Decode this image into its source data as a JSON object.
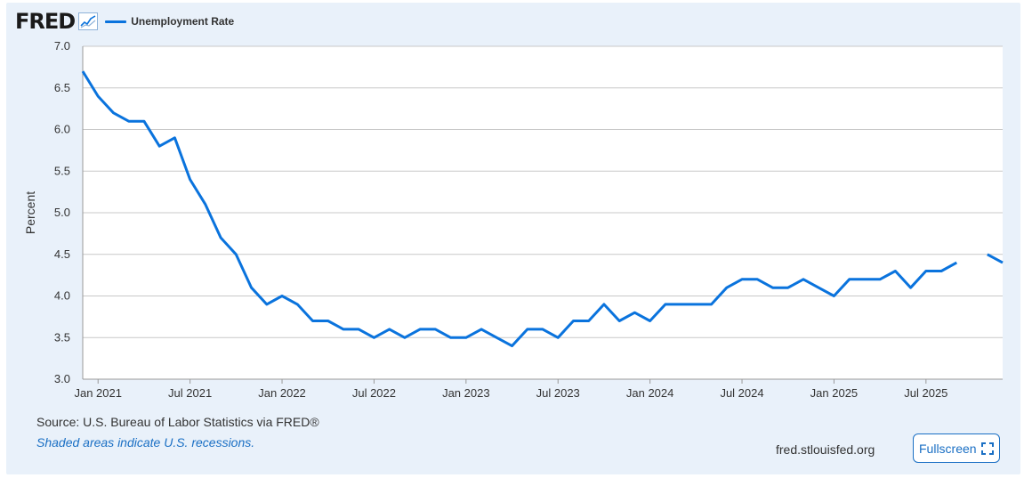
{
  "brand": {
    "logo_text": "FRED",
    "logo_mark_icon": "line-chart-icon"
  },
  "legend": {
    "label": "Unemployment Rate",
    "color": "#0a73dd"
  },
  "footer": {
    "source": "Source: U.S. Bureau of Labor Statistics via FRED®",
    "note": "Shaded areas indicate U.S. recessions.",
    "site": "fred.stlouisfed.org",
    "fullscreen_label": "Fullscreen",
    "fullscreen_icon": "expand-icon"
  },
  "colors": {
    "series": "#0a73dd",
    "panel": "#e9f1fa",
    "plot_bg": "#ffffff",
    "grid": "#c8c8c8",
    "link": "#1a6fc4"
  },
  "chart_data": {
    "type": "line",
    "ylabel": "Percent",
    "xlabel": "",
    "ylim": [
      3.0,
      7.0
    ],
    "ytick_labels": [
      "3.0",
      "3.5",
      "4.0",
      "4.5",
      "5.0",
      "5.5",
      "6.0",
      "6.5",
      "7.0"
    ],
    "yticks": [
      3.0,
      3.5,
      4.0,
      4.5,
      5.0,
      5.5,
      6.0,
      6.5,
      7.0
    ],
    "x_start": "2020-12",
    "x_end": "2025-12",
    "xtick_labels": [
      "Jan 2021",
      "Jul 2021",
      "Jan 2022",
      "Jul 2022",
      "Jan 2023",
      "Jul 2023",
      "Jan 2024",
      "Jul 2024",
      "Jan 2025",
      "Jul 2025"
    ],
    "xticks": [
      "2021-01",
      "2021-07",
      "2022-01",
      "2022-07",
      "2023-01",
      "2023-07",
      "2024-01",
      "2024-07",
      "2025-01",
      "2025-07"
    ],
    "grid": "horizontal",
    "series": [
      {
        "name": "Unemployment Rate",
        "color": "#0a73dd",
        "x": [
          "2020-12",
          "2021-01",
          "2021-02",
          "2021-03",
          "2021-04",
          "2021-05",
          "2021-06",
          "2021-07",
          "2021-08",
          "2021-09",
          "2021-10",
          "2021-11",
          "2021-12",
          "2022-01",
          "2022-02",
          "2022-03",
          "2022-04",
          "2022-05",
          "2022-06",
          "2022-07",
          "2022-08",
          "2022-09",
          "2022-10",
          "2022-11",
          "2022-12",
          "2023-01",
          "2023-02",
          "2023-03",
          "2023-04",
          "2023-05",
          "2023-06",
          "2023-07",
          "2023-08",
          "2023-09",
          "2023-10",
          "2023-11",
          "2023-12",
          "2024-01",
          "2024-02",
          "2024-03",
          "2024-04",
          "2024-05",
          "2024-06",
          "2024-07",
          "2024-08",
          "2024-09",
          "2024-10",
          "2024-11",
          "2024-12",
          "2025-01",
          "2025-02",
          "2025-03",
          "2025-04",
          "2025-05",
          "2025-06",
          "2025-07",
          "2025-08",
          "2025-09",
          "2025-10",
          "2025-11",
          "2025-12"
        ],
        "values": [
          6.7,
          6.4,
          6.2,
          6.1,
          6.1,
          5.8,
          5.9,
          5.4,
          5.1,
          4.7,
          4.5,
          4.1,
          3.9,
          4.0,
          3.9,
          3.7,
          3.7,
          3.6,
          3.6,
          3.5,
          3.6,
          3.5,
          3.6,
          3.6,
          3.5,
          3.5,
          3.6,
          3.5,
          3.4,
          3.6,
          3.6,
          3.5,
          3.7,
          3.7,
          3.9,
          3.7,
          3.8,
          3.7,
          3.9,
          3.9,
          3.9,
          3.9,
          4.1,
          4.2,
          4.2,
          4.1,
          4.1,
          4.2,
          4.1,
          4.0,
          4.2,
          4.2,
          4.2,
          4.3,
          4.1,
          4.3,
          4.3,
          4.4,
          null,
          4.5,
          4.4
        ]
      }
    ]
  }
}
